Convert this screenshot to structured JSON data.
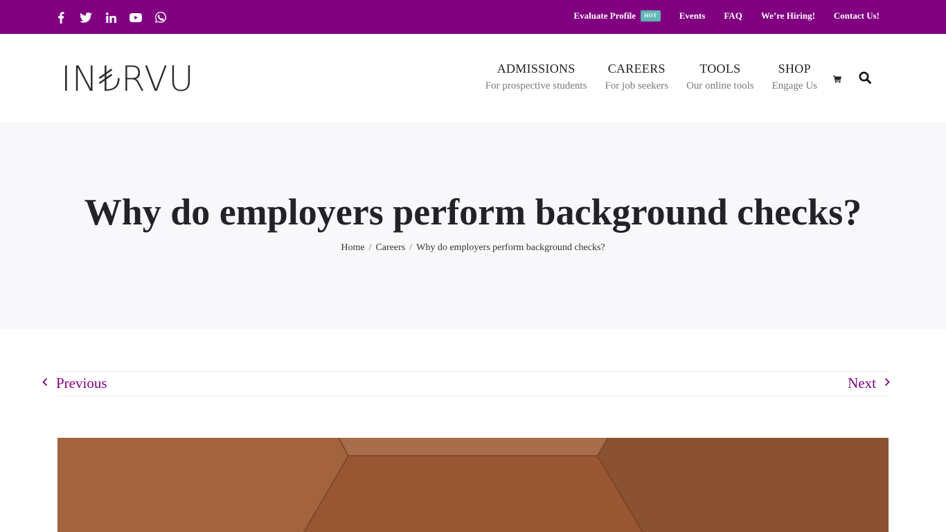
{
  "topbar": {
    "background": "#800080",
    "social": [
      {
        "icon": "facebook-icon",
        "label": "Facebook"
      },
      {
        "icon": "twitter-icon",
        "label": "Twitter"
      },
      {
        "icon": "linkedin-icon",
        "label": "LinkedIn"
      },
      {
        "icon": "youtube-icon",
        "label": "YouTube"
      },
      {
        "icon": "whatsapp-icon",
        "label": "WhatsApp"
      }
    ],
    "links": [
      {
        "label": "Evaluate Profile",
        "badge": "HOT"
      },
      {
        "label": "Events"
      },
      {
        "label": "FAQ"
      },
      {
        "label": "We’re Hiring!"
      },
      {
        "label": "Contact Us!"
      }
    ]
  },
  "header": {
    "logo": "IN₺RVU",
    "nav": [
      {
        "title": "ADMISSIONS",
        "subtitle": "For prospective students"
      },
      {
        "title": "CAREERS",
        "subtitle": "For job seekers"
      },
      {
        "title": "TOOLS",
        "subtitle": "Our online tools"
      },
      {
        "title": "SHOP",
        "subtitle": "Engage Us"
      }
    ],
    "icons": [
      "cart-icon",
      "search-icon"
    ]
  },
  "page": {
    "title": "Why do employers perform background checks?",
    "breadcrumb": [
      "Home",
      "Careers",
      "Why do employers perform background checks?"
    ],
    "breadcrumb_separator": "/"
  },
  "postnav": {
    "previous": "Previous",
    "next": "Next",
    "accent": "#800080"
  },
  "featured_image": {
    "description": "Brown geometric perspective illustration",
    "colors": [
      "#a3633c",
      "#a86d4a",
      "#995632",
      "#8a5230"
    ]
  }
}
